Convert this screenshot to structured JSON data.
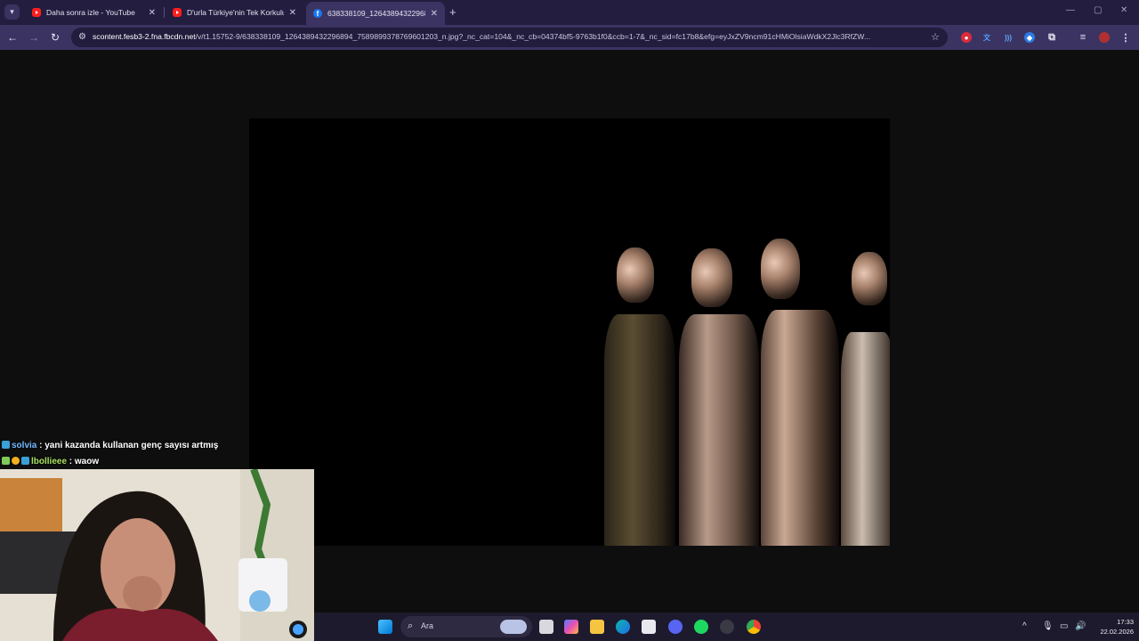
{
  "tabs": [
    {
      "title": "Daha sonra izle - YouTube",
      "favicon": "youtube-icon",
      "active": false
    },
    {
      "title": "D'urla Türkiye'nin Tek Korkuluk",
      "favicon": "youtube-icon",
      "active": false
    },
    {
      "title": "638338109_1264389432296894",
      "favicon": "facebook-icon",
      "active": true
    }
  ],
  "address_bar": {
    "url_host": "scontent.fesb3-2.fna.fbcdn.net",
    "url_rest": "/v/t1.15752-9/638338109_1264389432296894_7589899378769601203_n.jpg?_nc_cat=104&_nc_cb=04374bf5-9763b1f0&ccb=1-7&_nc_sid=fc17b8&efg=eyJxZV9ncm91cHMiOlsiaWdkX2Jlc3RfZW..."
  },
  "chat": [
    {
      "user": "solvia",
      "message": ": yani kazanda kullanan genç sayısı artmış"
    },
    {
      "user": "lbollieee",
      "message": ": waow"
    }
  ],
  "taskbar": {
    "search_placeholder": "Ara",
    "time": "17:33",
    "date": "22.02.2026"
  },
  "colors": {
    "tabstrip": "#231d3f",
    "toolbar": "#3b3462",
    "chat_user1": "#74b9ff",
    "chat_user2": "#a8e05f",
    "taskbar": "#1d1a2e"
  }
}
